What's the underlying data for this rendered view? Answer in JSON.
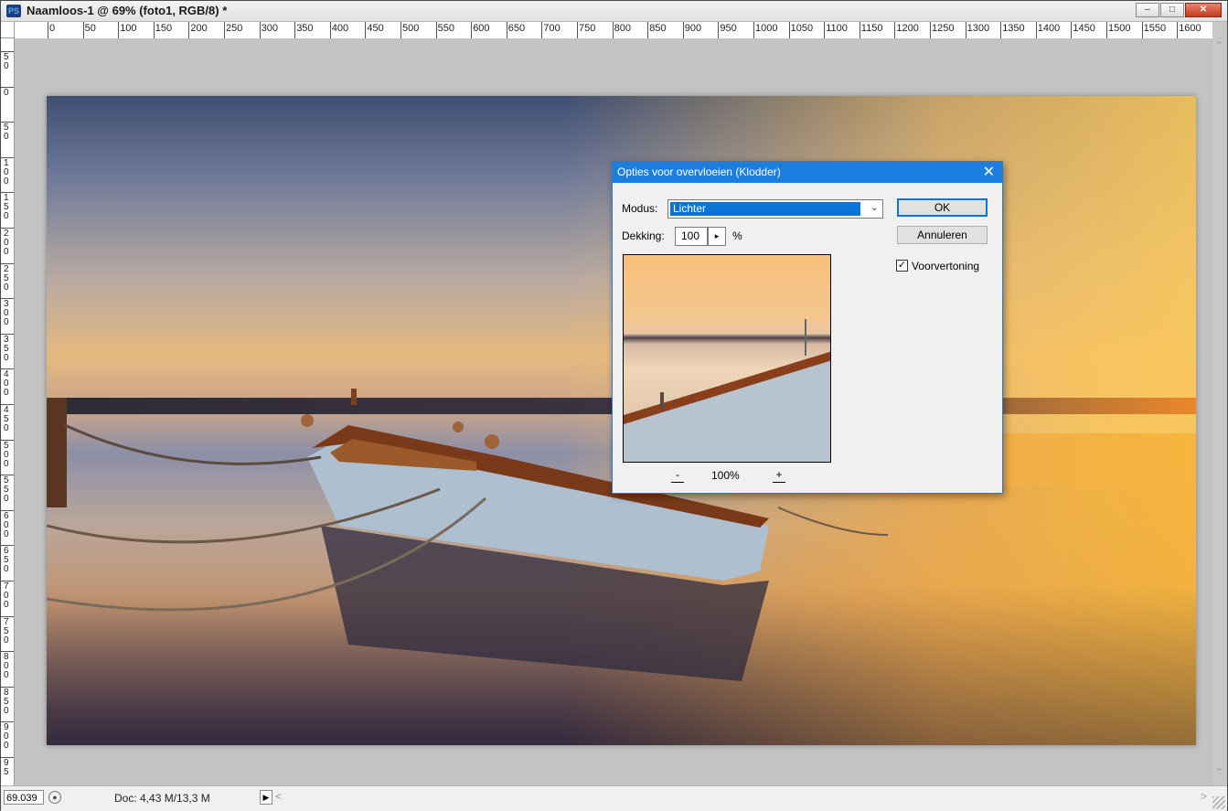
{
  "window": {
    "app_icon": "PS",
    "title": "Naamloos-1 @ 69% (foto1, RGB/8) *",
    "buttons": {
      "minimize": "minimize-icon",
      "maximize": "maximize-icon",
      "close": "close-icon"
    }
  },
  "ruler": {
    "horizontal_labels": [
      "0",
      "50",
      "100",
      "150",
      "200",
      "250",
      "300",
      "350",
      "400",
      "450",
      "500",
      "550",
      "600",
      "650",
      "700",
      "750",
      "800",
      "850",
      "900",
      "950",
      "1000",
      "1050",
      "1100",
      "1150",
      "1200",
      "1250",
      "1300",
      "1350",
      "1400",
      "1450",
      "1500",
      "1550",
      "1600",
      "16"
    ],
    "vertical_labels": [
      "5 0",
      "0",
      "5 0",
      "1 0 0",
      "1 5 0",
      "2 0 0",
      "2 5 0",
      "3 0 0",
      "3 5 0",
      "4 0 0",
      "4 5 0",
      "5 0 0",
      "5 5 0",
      "6 0 0",
      "6 5 0",
      "7 0 0",
      "7 5 0",
      "8 0 0",
      "8 5 0",
      "9 0 0",
      "9 5"
    ]
  },
  "status": {
    "zoom": "69.039",
    "doc": "Doc: 4,43 M/13,3 M"
  },
  "dialog": {
    "title": "Opties voor overvloeien (Klodder)",
    "mode_label": "Modus:",
    "mode_value": "Lichter",
    "opacity_label": "Dekking:",
    "opacity_value": "100",
    "percent": "%",
    "ok": "OK",
    "cancel": "Annuleren",
    "preview_label": "Voorvertoning",
    "preview_checked": true,
    "zoom_minus": "-",
    "zoom_value": "100%",
    "zoom_plus": "+"
  }
}
